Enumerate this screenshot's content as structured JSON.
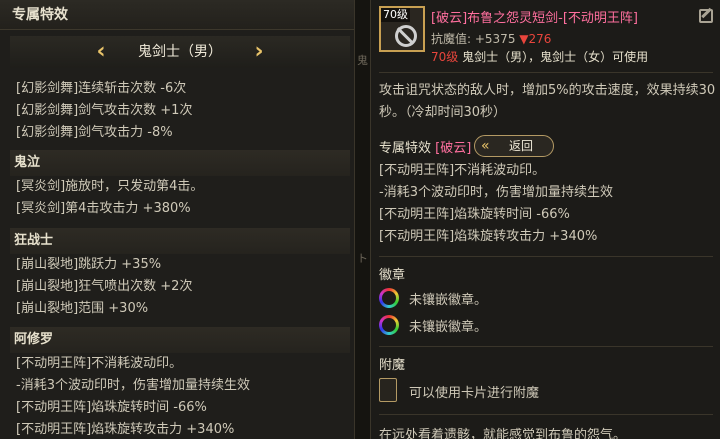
{
  "left": {
    "header": "专属特效",
    "selector": {
      "label": "鬼剑士（男）"
    },
    "groups": [
      {
        "title": "",
        "lines": [
          "[幻影剑舞]连续斩击次数 -6次",
          "[幻影剑舞]剑气攻击次数 +1次",
          "[幻影剑舞]剑气攻击力 -8%"
        ]
      },
      {
        "title": "鬼泣",
        "lines": [
          "[冥炎剑]施放时，只发动第4击。",
          "[冥炎剑]第4击攻击力 +380%"
        ]
      },
      {
        "title": "狂战士",
        "lines": [
          "[崩山裂地]跳跃力 +35%",
          "[崩山裂地]狂气喷出次数 +2次",
          "[崩山裂地]范围 +30%"
        ]
      },
      {
        "title": "阿修罗",
        "lines": [
          "[不动明王阵]不消耗波动印。",
          "-消耗3个波动印时，伤害增加量持续生效",
          "[不动明王阵]焰珠旋转时间 -66%",
          "[不动明王阵]焰珠旋转攻击力 +340%"
        ]
      }
    ]
  },
  "gap": {
    "marks": [
      "鬼",
      "ト"
    ]
  },
  "right": {
    "item": {
      "level_tag": "70级",
      "name": "[破云]布鲁之怨灵短剑-[不动明王阵]",
      "stat_label": "抗魔值: +5375",
      "stat_down": "▼276",
      "usable_level": "70级",
      "usable_text": " 鬼剑士（男），鬼剑士（女）可使用"
    },
    "description": "攻击诅咒状态的敌人时，增加5%的攻击速度，效果持续30秒。（冷却时间30秒）",
    "exclusive": {
      "title": "专属特效",
      "tag": "[破云]",
      "back_label": "返回",
      "lines": [
        "[不动明王阵]不消耗波动印。",
        "-消耗3个波动印时，伤害增加量持续生效",
        "[不动明王阵]焰珠旋转时间 -66%",
        "[不动明王阵]焰珠旋转攻击力 +340%"
      ]
    },
    "emblem": {
      "title": "徽章",
      "slots": [
        "未镶嵌徽章。",
        "未镶嵌徽章。"
      ]
    },
    "enchant": {
      "title": "附魔",
      "text": "可以使用卡片进行附魔"
    },
    "flavor": "在远处看着遗骸，就能感觉到布鲁的怨气。"
  },
  "colors": {
    "accent_gold": "#e9c46a",
    "item_name_pink": "#ff6f9e",
    "stat_down_red": "#e8453c"
  }
}
